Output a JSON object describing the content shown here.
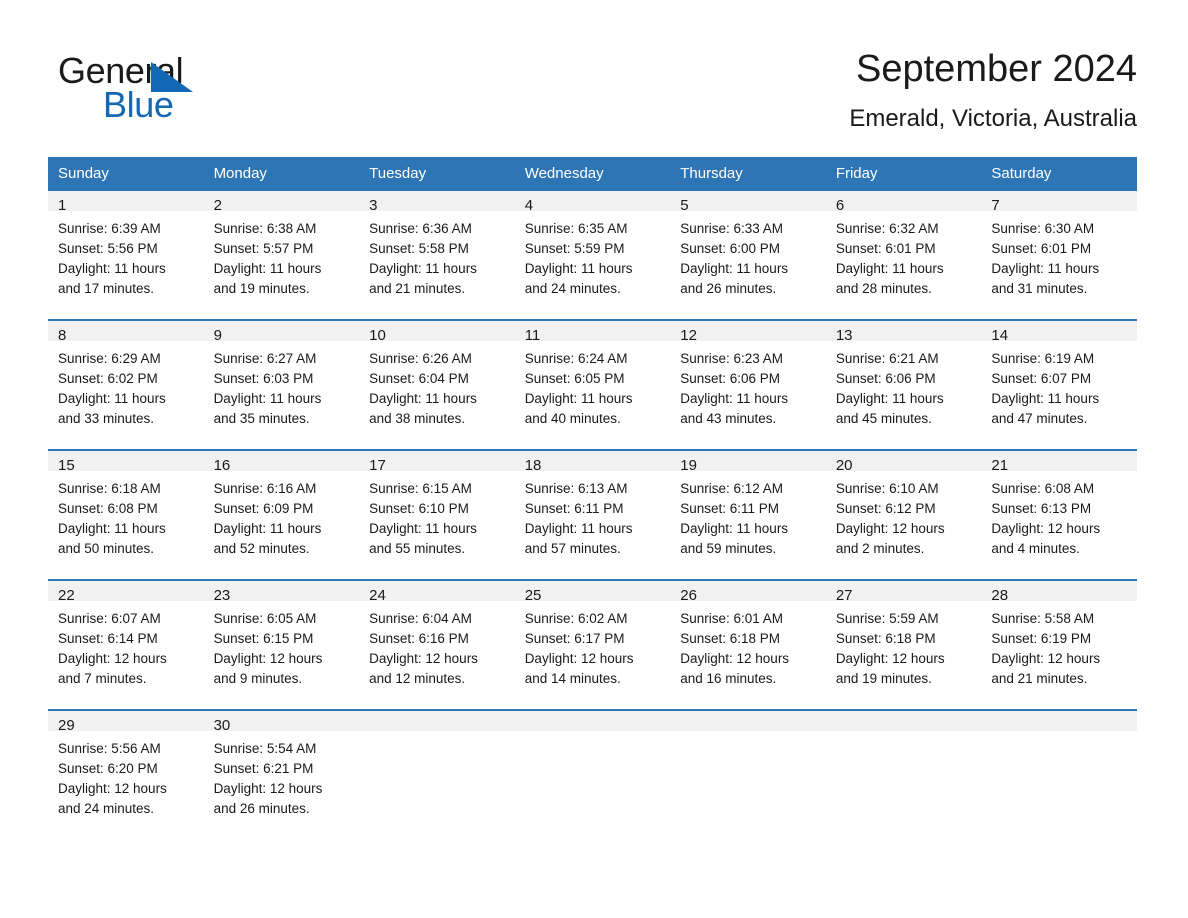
{
  "logo": {
    "word_one": "General",
    "word_two": "Blue",
    "triangle_color": "#1268b3"
  },
  "header": {
    "title": "September 2024",
    "location": "Emerald, Victoria, Australia"
  },
  "theme": {
    "header_blue": "#2E75B6",
    "daynum_band": "#f1f1f1",
    "text": "#1a1a1a"
  },
  "columns": [
    "Sunday",
    "Monday",
    "Tuesday",
    "Wednesday",
    "Thursday",
    "Friday",
    "Saturday"
  ],
  "weeks": [
    [
      {
        "day": "1",
        "sunrise": "Sunrise: 6:39 AM",
        "sunset": "Sunset: 5:56 PM",
        "daylight": "Daylight: 11 hours and 17 minutes."
      },
      {
        "day": "2",
        "sunrise": "Sunrise: 6:38 AM",
        "sunset": "Sunset: 5:57 PM",
        "daylight": "Daylight: 11 hours and 19 minutes."
      },
      {
        "day": "3",
        "sunrise": "Sunrise: 6:36 AM",
        "sunset": "Sunset: 5:58 PM",
        "daylight": "Daylight: 11 hours and 21 minutes."
      },
      {
        "day": "4",
        "sunrise": "Sunrise: 6:35 AM",
        "sunset": "Sunset: 5:59 PM",
        "daylight": "Daylight: 11 hours and 24 minutes."
      },
      {
        "day": "5",
        "sunrise": "Sunrise: 6:33 AM",
        "sunset": "Sunset: 6:00 PM",
        "daylight": "Daylight: 11 hours and 26 minutes."
      },
      {
        "day": "6",
        "sunrise": "Sunrise: 6:32 AM",
        "sunset": "Sunset: 6:01 PM",
        "daylight": "Daylight: 11 hours and 28 minutes."
      },
      {
        "day": "7",
        "sunrise": "Sunrise: 6:30 AM",
        "sunset": "Sunset: 6:01 PM",
        "daylight": "Daylight: 11 hours and 31 minutes."
      }
    ],
    [
      {
        "day": "8",
        "sunrise": "Sunrise: 6:29 AM",
        "sunset": "Sunset: 6:02 PM",
        "daylight": "Daylight: 11 hours and 33 minutes."
      },
      {
        "day": "9",
        "sunrise": "Sunrise: 6:27 AM",
        "sunset": "Sunset: 6:03 PM",
        "daylight": "Daylight: 11 hours and 35 minutes."
      },
      {
        "day": "10",
        "sunrise": "Sunrise: 6:26 AM",
        "sunset": "Sunset: 6:04 PM",
        "daylight": "Daylight: 11 hours and 38 minutes."
      },
      {
        "day": "11",
        "sunrise": "Sunrise: 6:24 AM",
        "sunset": "Sunset: 6:05 PM",
        "daylight": "Daylight: 11 hours and 40 minutes."
      },
      {
        "day": "12",
        "sunrise": "Sunrise: 6:23 AM",
        "sunset": "Sunset: 6:06 PM",
        "daylight": "Daylight: 11 hours and 43 minutes."
      },
      {
        "day": "13",
        "sunrise": "Sunrise: 6:21 AM",
        "sunset": "Sunset: 6:06 PM",
        "daylight": "Daylight: 11 hours and 45 minutes."
      },
      {
        "day": "14",
        "sunrise": "Sunrise: 6:19 AM",
        "sunset": "Sunset: 6:07 PM",
        "daylight": "Daylight: 11 hours and 47 minutes."
      }
    ],
    [
      {
        "day": "15",
        "sunrise": "Sunrise: 6:18 AM",
        "sunset": "Sunset: 6:08 PM",
        "daylight": "Daylight: 11 hours and 50 minutes."
      },
      {
        "day": "16",
        "sunrise": "Sunrise: 6:16 AM",
        "sunset": "Sunset: 6:09 PM",
        "daylight": "Daylight: 11 hours and 52 minutes."
      },
      {
        "day": "17",
        "sunrise": "Sunrise: 6:15 AM",
        "sunset": "Sunset: 6:10 PM",
        "daylight": "Daylight: 11 hours and 55 minutes."
      },
      {
        "day": "18",
        "sunrise": "Sunrise: 6:13 AM",
        "sunset": "Sunset: 6:11 PM",
        "daylight": "Daylight: 11 hours and 57 minutes."
      },
      {
        "day": "19",
        "sunrise": "Sunrise: 6:12 AM",
        "sunset": "Sunset: 6:11 PM",
        "daylight": "Daylight: 11 hours and 59 minutes."
      },
      {
        "day": "20",
        "sunrise": "Sunrise: 6:10 AM",
        "sunset": "Sunset: 6:12 PM",
        "daylight": "Daylight: 12 hours and 2 minutes."
      },
      {
        "day": "21",
        "sunrise": "Sunrise: 6:08 AM",
        "sunset": "Sunset: 6:13 PM",
        "daylight": "Daylight: 12 hours and 4 minutes."
      }
    ],
    [
      {
        "day": "22",
        "sunrise": "Sunrise: 6:07 AM",
        "sunset": "Sunset: 6:14 PM",
        "daylight": "Daylight: 12 hours and 7 minutes."
      },
      {
        "day": "23",
        "sunrise": "Sunrise: 6:05 AM",
        "sunset": "Sunset: 6:15 PM",
        "daylight": "Daylight: 12 hours and 9 minutes."
      },
      {
        "day": "24",
        "sunrise": "Sunrise: 6:04 AM",
        "sunset": "Sunset: 6:16 PM",
        "daylight": "Daylight: 12 hours and 12 minutes."
      },
      {
        "day": "25",
        "sunrise": "Sunrise: 6:02 AM",
        "sunset": "Sunset: 6:17 PM",
        "daylight": "Daylight: 12 hours and 14 minutes."
      },
      {
        "day": "26",
        "sunrise": "Sunrise: 6:01 AM",
        "sunset": "Sunset: 6:18 PM",
        "daylight": "Daylight: 12 hours and 16 minutes."
      },
      {
        "day": "27",
        "sunrise": "Sunrise: 5:59 AM",
        "sunset": "Sunset: 6:18 PM",
        "daylight": "Daylight: 12 hours and 19 minutes."
      },
      {
        "day": "28",
        "sunrise": "Sunrise: 5:58 AM",
        "sunset": "Sunset: 6:19 PM",
        "daylight": "Daylight: 12 hours and 21 minutes."
      }
    ],
    [
      {
        "day": "29",
        "sunrise": "Sunrise: 5:56 AM",
        "sunset": "Sunset: 6:20 PM",
        "daylight": "Daylight: 12 hours and 24 minutes."
      },
      {
        "day": "30",
        "sunrise": "Sunrise: 5:54 AM",
        "sunset": "Sunset: 6:21 PM",
        "daylight": "Daylight: 12 hours and 26 minutes."
      },
      {
        "day": "",
        "sunrise": "",
        "sunset": "",
        "daylight": ""
      },
      {
        "day": "",
        "sunrise": "",
        "sunset": "",
        "daylight": ""
      },
      {
        "day": "",
        "sunrise": "",
        "sunset": "",
        "daylight": ""
      },
      {
        "day": "",
        "sunrise": "",
        "sunset": "",
        "daylight": ""
      },
      {
        "day": "",
        "sunrise": "",
        "sunset": "",
        "daylight": ""
      }
    ]
  ]
}
